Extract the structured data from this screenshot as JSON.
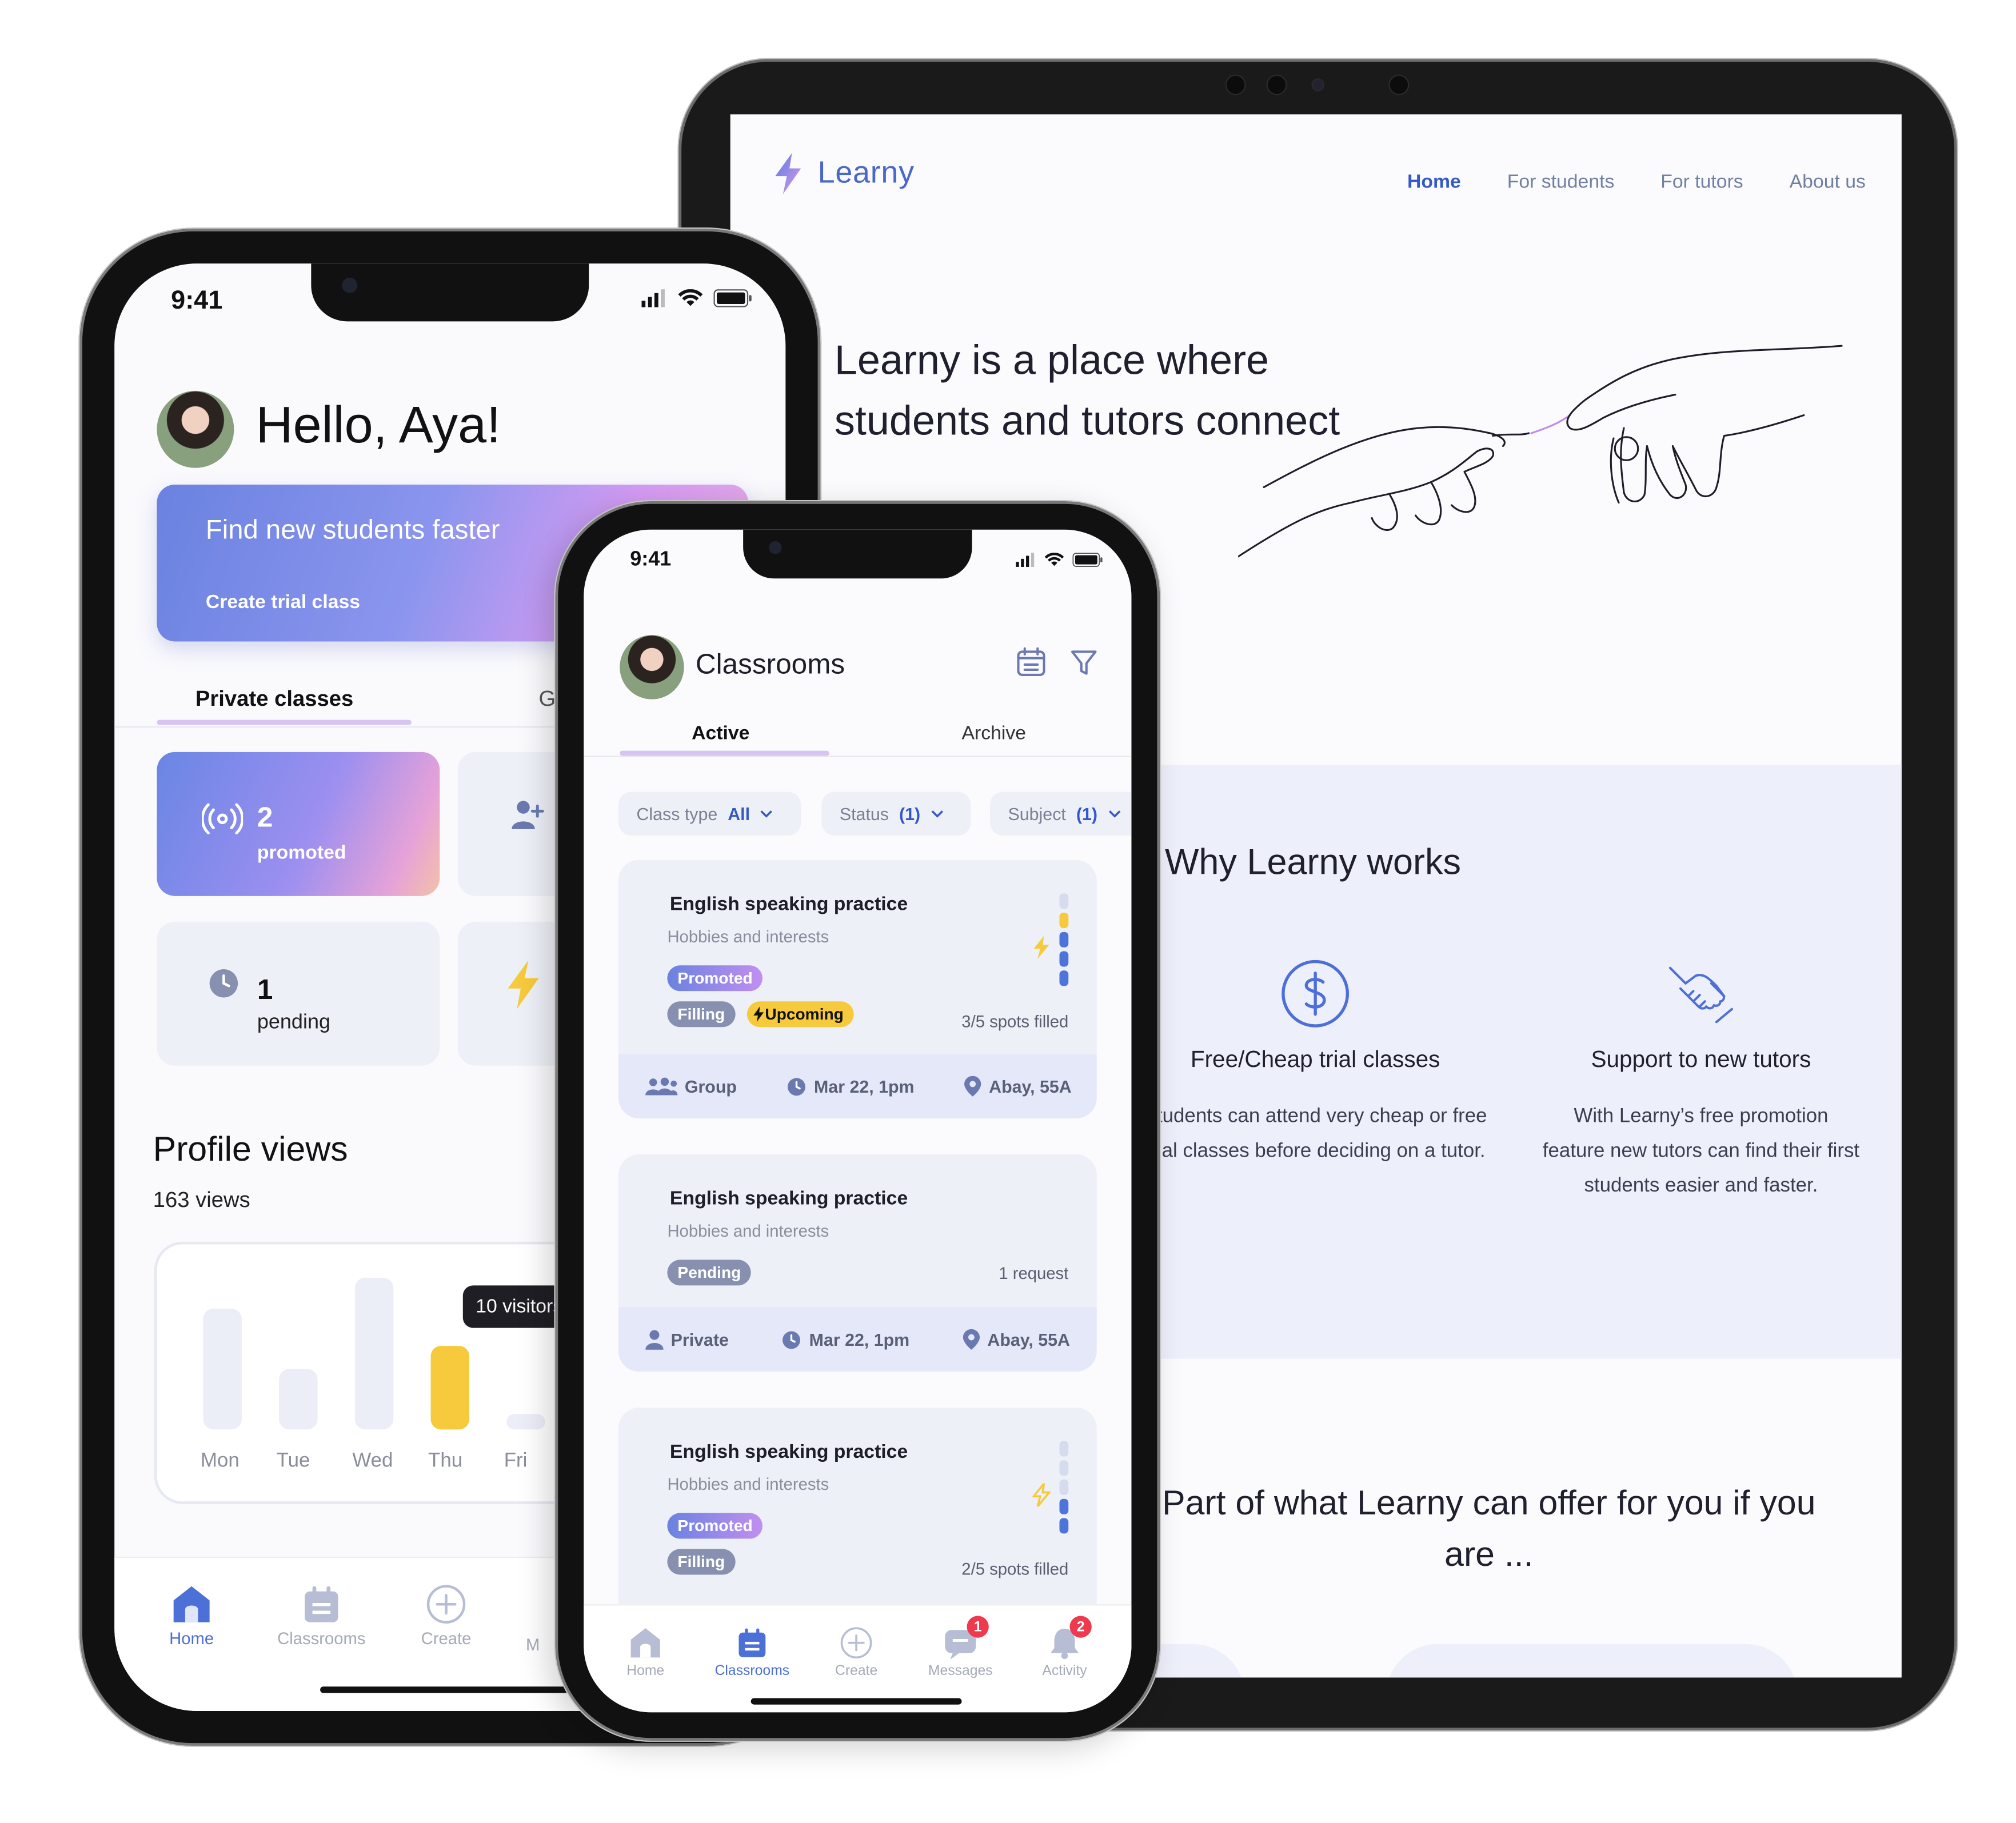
{
  "brand": {
    "name": "Learny",
    "accent": "#3558c7"
  },
  "tablet": {
    "nav": [
      {
        "label": "Home",
        "active": true
      },
      {
        "label": "For students",
        "active": false
      },
      {
        "label": "For tutors",
        "active": false
      },
      {
        "label": "About us",
        "active": false
      }
    ],
    "hero": "Learny is a place where students and tutors connect",
    "why_title": "Why Learny works",
    "features": [
      {
        "icon": "dollar-circle-icon",
        "title": "Free/Cheap trial classes",
        "desc": "Students can attend very cheap or free trial classes before deciding on a tutor."
      },
      {
        "icon": "handshake-icon",
        "title": "Support to new tutors",
        "desc": "With Learny’s free promotion feature new tutors can find their first students easier and faster."
      }
    ],
    "offer": "Part of what Learny can offer for you if you are ..."
  },
  "phone1": {
    "time": "9:41",
    "greeting": "Hello, Aya!",
    "banner": {
      "title": "Find new students faster",
      "cta": "Create trial class"
    },
    "tabs": [
      "Private classes",
      "G"
    ],
    "stats": [
      {
        "icon": "broadcast-icon",
        "value": "2",
        "label": "promoted"
      },
      {
        "icon": "add-user-icon",
        "value": "",
        "label": ""
      },
      {
        "icon": "clock-icon",
        "value": "1",
        "label": "pending"
      },
      {
        "icon": "lightning-icon",
        "value": "",
        "label": ""
      }
    ],
    "profile_views": {
      "title": "Profile views",
      "subtitle": "163 views",
      "tooltip": "10 visitors"
    },
    "chart_data": {
      "type": "bar",
      "categories": [
        "Mon",
        "Tue",
        "Wed",
        "Thu",
        "Fri"
      ],
      "values": [
        8,
        4,
        10,
        5.5,
        1
      ],
      "highlight": "Thu",
      "highlight_color": "#f7c93c",
      "bar_color": "#eceef7"
    },
    "nav": [
      {
        "label": "Home",
        "icon": "home-icon",
        "active": true
      },
      {
        "label": "Classrooms",
        "icon": "calendar-icon",
        "active": false
      },
      {
        "label": "Create",
        "icon": "plus-circle-icon",
        "active": false
      },
      {
        "label": "M",
        "icon": "",
        "active": false
      }
    ]
  },
  "phone2": {
    "time": "9:41",
    "title": "Classrooms",
    "tabs": {
      "active": "Active",
      "other": "Archive"
    },
    "filters": [
      {
        "label": "Class type",
        "value": "All"
      },
      {
        "label": "Status",
        "value": "(1)"
      },
      {
        "label": "Subject",
        "value": "(1)"
      }
    ],
    "classes": [
      {
        "title": "English speaking practice",
        "subtitle": "Hobbies and interests",
        "pills": [
          "Promoted",
          "Filling",
          "Upcoming"
        ],
        "meta": "3/5 spots filled",
        "footer": {
          "type": "Group",
          "date": "Mar 22, 1pm",
          "place": "Abay, 55A"
        },
        "spots_filled": 3,
        "spots_total": 5
      },
      {
        "title": "English speaking practice",
        "subtitle": "Hobbies and interests",
        "pills": [
          "Pending"
        ],
        "meta": "1 request",
        "footer": {
          "type": "Private",
          "date": "Mar 22, 1pm",
          "place": "Abay, 55A"
        }
      },
      {
        "title": "English speaking practice",
        "subtitle": "Hobbies and interests",
        "pills": [
          "Promoted",
          "Filling"
        ],
        "meta": "2/5 spots filled",
        "spots_filled": 2,
        "spots_total": 5
      }
    ],
    "nav": [
      {
        "label": "Home",
        "icon": "home-icon",
        "badge": ""
      },
      {
        "label": "Classrooms",
        "icon": "calendar-icon",
        "badge": ""
      },
      {
        "label": "Create",
        "icon": "plus-circle-icon",
        "badge": ""
      },
      {
        "label": "Messages",
        "icon": "chat-icon",
        "badge": "1"
      },
      {
        "label": "Activity",
        "icon": "bell-icon",
        "badge": "2"
      }
    ]
  }
}
